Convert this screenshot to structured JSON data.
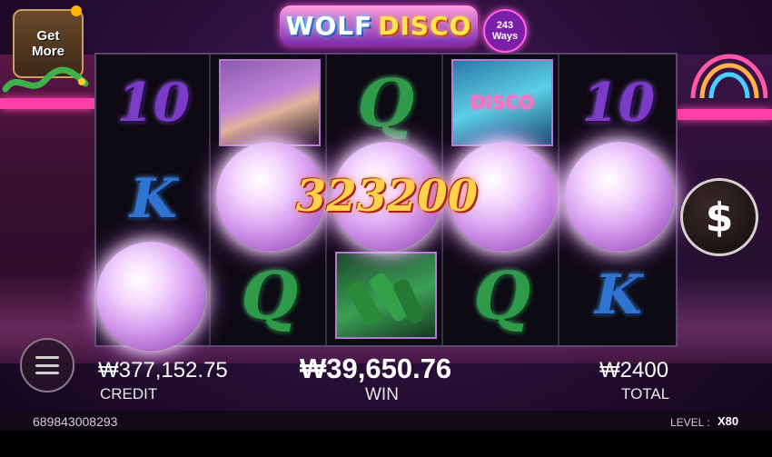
{
  "title": {
    "word1": "WOLF",
    "word2": "DISCO",
    "ways_number": "243",
    "ways_label": "Ways"
  },
  "get_more": {
    "line1": "Get",
    "line2": "More"
  },
  "reels": [
    {
      "symbols": [
        "10",
        "K",
        "ball"
      ]
    },
    {
      "symbols": [
        "woman",
        "ball",
        "Q"
      ]
    },
    {
      "symbols": [
        "Q",
        "ball",
        "bottles"
      ]
    },
    {
      "symbols": [
        "DISCO",
        "ball",
        "Q"
      ]
    },
    {
      "symbols": [
        "10",
        "ball",
        "K"
      ]
    }
  ],
  "disco_sign_text": "DISCO",
  "win_display": "323200",
  "spin_button_symbol": "$",
  "credit": {
    "value": "₩377,152.75",
    "label": "CREDIT"
  },
  "win": {
    "value": "₩39,650.76",
    "label": "WIN"
  },
  "total": {
    "value": "₩2400",
    "label": "TOTAL"
  },
  "game_id": "689843008293",
  "level": {
    "label": "LEVEL :",
    "value": "X80"
  },
  "colors": {
    "accent_pink": "#ff3fa8",
    "win_gold": "#ffd24a",
    "symbol_10": "#7a3cc6",
    "symbol_q": "#2f9a4a",
    "symbol_k": "#2f74d0"
  },
  "icons": [
    "dollar-sign-icon",
    "hamburger-menu-icon",
    "dragon-icon",
    "neon-arch-icon"
  ]
}
